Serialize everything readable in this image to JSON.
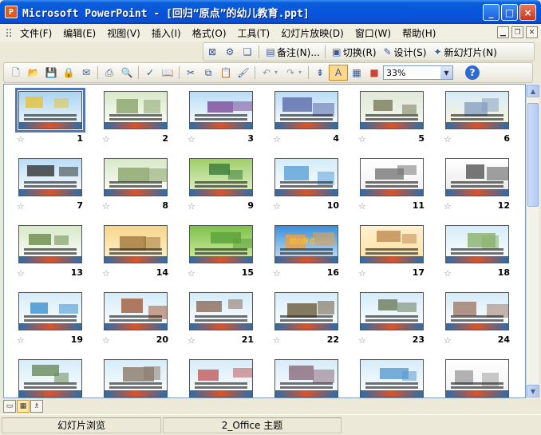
{
  "window": {
    "icon_label": "P",
    "title": "Microsoft PowerPoint - [回归“原点”的幼儿教育.ppt]",
    "minimize": "_",
    "maximize": "□",
    "close": "×"
  },
  "menu": {
    "items": [
      {
        "label": "文件(F)"
      },
      {
        "label": "编辑(E)"
      },
      {
        "label": "视图(V)"
      },
      {
        "label": "插入(I)"
      },
      {
        "label": "格式(O)"
      },
      {
        "label": "工具(T)"
      },
      {
        "label": "幻灯片放映(D)"
      },
      {
        "label": "窗口(W)"
      },
      {
        "label": "帮助(H)"
      }
    ]
  },
  "slide_sorter_toolbar": {
    "notes_label": "备注(N)...",
    "transition_label": "切换(R)",
    "design_label": "设计(S)",
    "new_slide_label": "新幻灯片(N)"
  },
  "standard_toolbar": {
    "zoom_value": "33%",
    "help": "?"
  },
  "slides": [
    {
      "number": "1",
      "selected": true
    },
    {
      "number": "2"
    },
    {
      "number": "3"
    },
    {
      "number": "4"
    },
    {
      "number": "5"
    },
    {
      "number": "6"
    },
    {
      "number": "7"
    },
    {
      "number": "8"
    },
    {
      "number": "9"
    },
    {
      "number": "10"
    },
    {
      "number": "11"
    },
    {
      "number": "12"
    },
    {
      "number": "13"
    },
    {
      "number": "14"
    },
    {
      "number": "15"
    },
    {
      "number": "16"
    },
    {
      "number": "17"
    },
    {
      "number": "18"
    },
    {
      "number": "19"
    },
    {
      "number": "20"
    },
    {
      "number": "21"
    },
    {
      "number": "22"
    },
    {
      "number": "23"
    },
    {
      "number": "24"
    },
    {
      "number": ""
    },
    {
      "number": ""
    },
    {
      "number": ""
    },
    {
      "number": ""
    },
    {
      "number": ""
    },
    {
      "number": ""
    }
  ],
  "slide_16_title": "回归原点",
  "statusbar": {
    "view": "幻灯片浏览",
    "theme": "2_Office 主题"
  }
}
